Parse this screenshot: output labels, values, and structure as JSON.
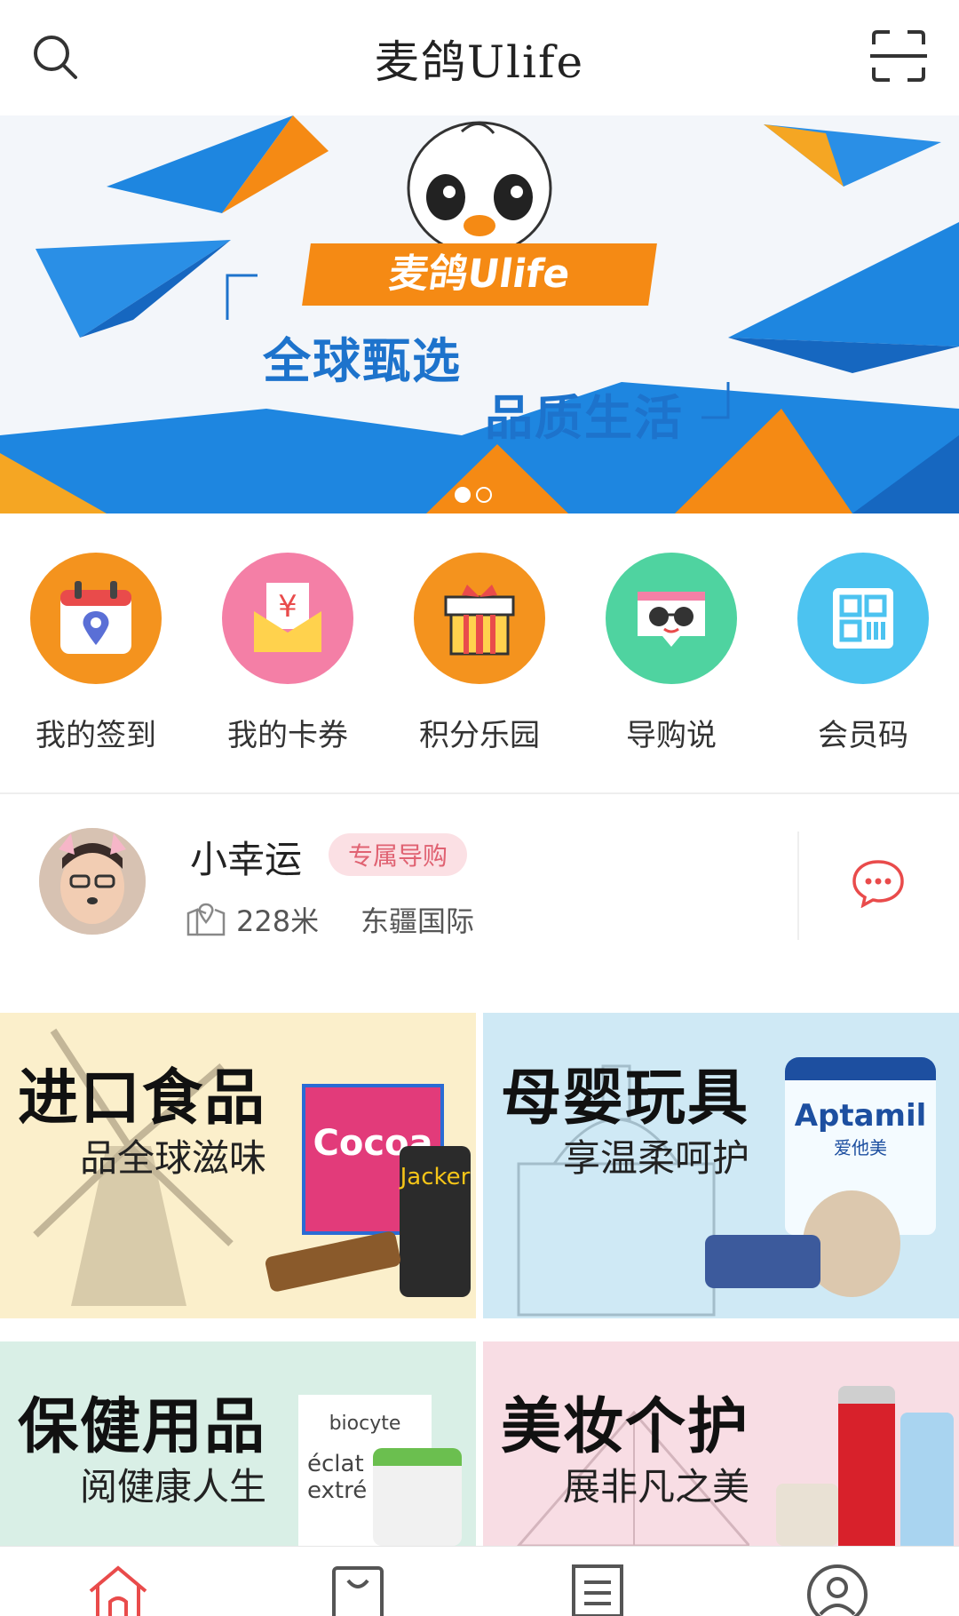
{
  "header": {
    "title": "麦鸽Ulife",
    "search_icon": "search-icon",
    "scan_icon": "scan-icon"
  },
  "banner": {
    "brand": "麦鸽Ulife",
    "slogan_line1": "全球甄选",
    "slogan_line2": "品质生活",
    "slides": 2,
    "active_slide": 1,
    "colors": {
      "orange": "#f58a14",
      "blue": "#1d73cc"
    }
  },
  "quick_actions": [
    {
      "label": "我的签到",
      "icon": "calendar-pin-icon",
      "color": "#f4931e"
    },
    {
      "label": "我的卡券",
      "icon": "coupon-envelope-icon",
      "color": "#f47fa6"
    },
    {
      "label": "积分乐园",
      "icon": "gift-box-icon",
      "color": "#f4931e"
    },
    {
      "label": "导购说",
      "icon": "sunglasses-chat-icon",
      "color": "#4fd3a0"
    },
    {
      "label": "会员码",
      "icon": "qr-code-icon",
      "color": "#4cc3f0"
    }
  ],
  "guide": {
    "name": "小幸运",
    "badge": "专属导购",
    "distance": "228米",
    "place": "东疆国际"
  },
  "categories": [
    {
      "title": "进口食品",
      "subtitle": "品全球滋味",
      "bg": "#fbefcb"
    },
    {
      "title": "母婴玩具",
      "subtitle": "享温柔呵护",
      "bg": "#cfe9f5"
    },
    {
      "title": "保健用品",
      "subtitle": "阅健康人生",
      "bg": "#d9efe6"
    },
    {
      "title": "美妆个护",
      "subtitle": "展非凡之美",
      "bg": "#f8dde4"
    }
  ],
  "product_text": {
    "food_box": "Cocoa",
    "food_can": "Jacker",
    "milk": "Aptamil",
    "milk_cn": "爱他美",
    "vitamin": "biocyte",
    "vitamin2": "éclat",
    "vitamin3": "extré"
  },
  "bottom_nav": [
    {
      "icon": "home-icon",
      "active": true
    },
    {
      "icon": "shopping-bag-icon",
      "active": false
    },
    {
      "icon": "orders-list-icon",
      "active": false
    },
    {
      "icon": "profile-icon",
      "active": false
    }
  ]
}
